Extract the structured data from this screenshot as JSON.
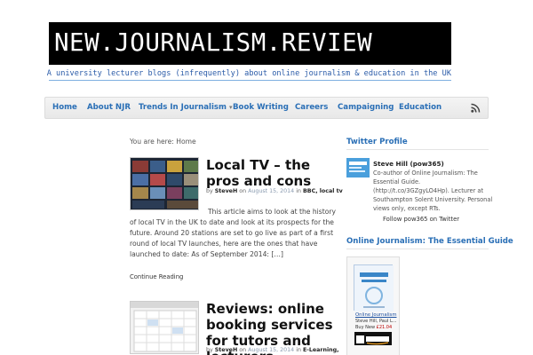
{
  "header": {
    "site_title": "NEW.JOURNALISM.REVIEW",
    "tagline": "A university lecturer blogs (infrequently) about online journalism & education in the UK"
  },
  "nav": {
    "items": [
      {
        "label": "Home"
      },
      {
        "label": "About NJR"
      },
      {
        "label": "Trends In Journalism"
      },
      {
        "label": "Book Writing"
      },
      {
        "label": "Careers"
      },
      {
        "label": "Campaigning"
      },
      {
        "label": "Education"
      }
    ],
    "rss_icon": "rss-icon"
  },
  "breadcrumb": {
    "prefix": "You are here:",
    "current": "Home"
  },
  "posts": [
    {
      "title": "Local TV – the pros and cons",
      "by": "by",
      "author": "SteveH",
      "on": "on",
      "date": "August 15, 2014",
      "in": "in",
      "categories": "BBC, local tv",
      "excerpt": "This article aims to look at the history of local TV in the UK to date and look at its prospects for the future.  Around 20 stations are set to go live as part of a first round of local TV launches, here are the ones that have launched to date: As of September 2014:  […]",
      "continue": "Continue Reading"
    },
    {
      "title": "Reviews: online booking services for tutors and lecturers",
      "by": "by",
      "author": "SteveH",
      "on": "on",
      "date": "August 15, 2014",
      "in": "in",
      "categories": "E-Learning,"
    }
  ],
  "sidebar": {
    "twitter_heading": "Twitter Profile",
    "twitter_name": "Steve Hill (pow365)",
    "twitter_bio": "Co-author of Online Journalism: The Essential Guide. (http://t.co/3GZgyLO4Hp). Lecturer at Southampton Solent University. Personal views only, except RTs.",
    "twitter_follow": "Follow pow365 on Twitter",
    "book_heading": "Online Journalism: The Essential Guide",
    "book_link": "Online Journalism",
    "book_author": "Steve Hill, Paul L...",
    "book_price_label": "Buy New",
    "book_price": "£21.04",
    "amazon_badge": "Buy from amazon.co.uk"
  },
  "colors": {
    "link_blue": "#2a6fb6",
    "banner_black": "#000000",
    "tagline_blue": "#2a5ba8"
  }
}
